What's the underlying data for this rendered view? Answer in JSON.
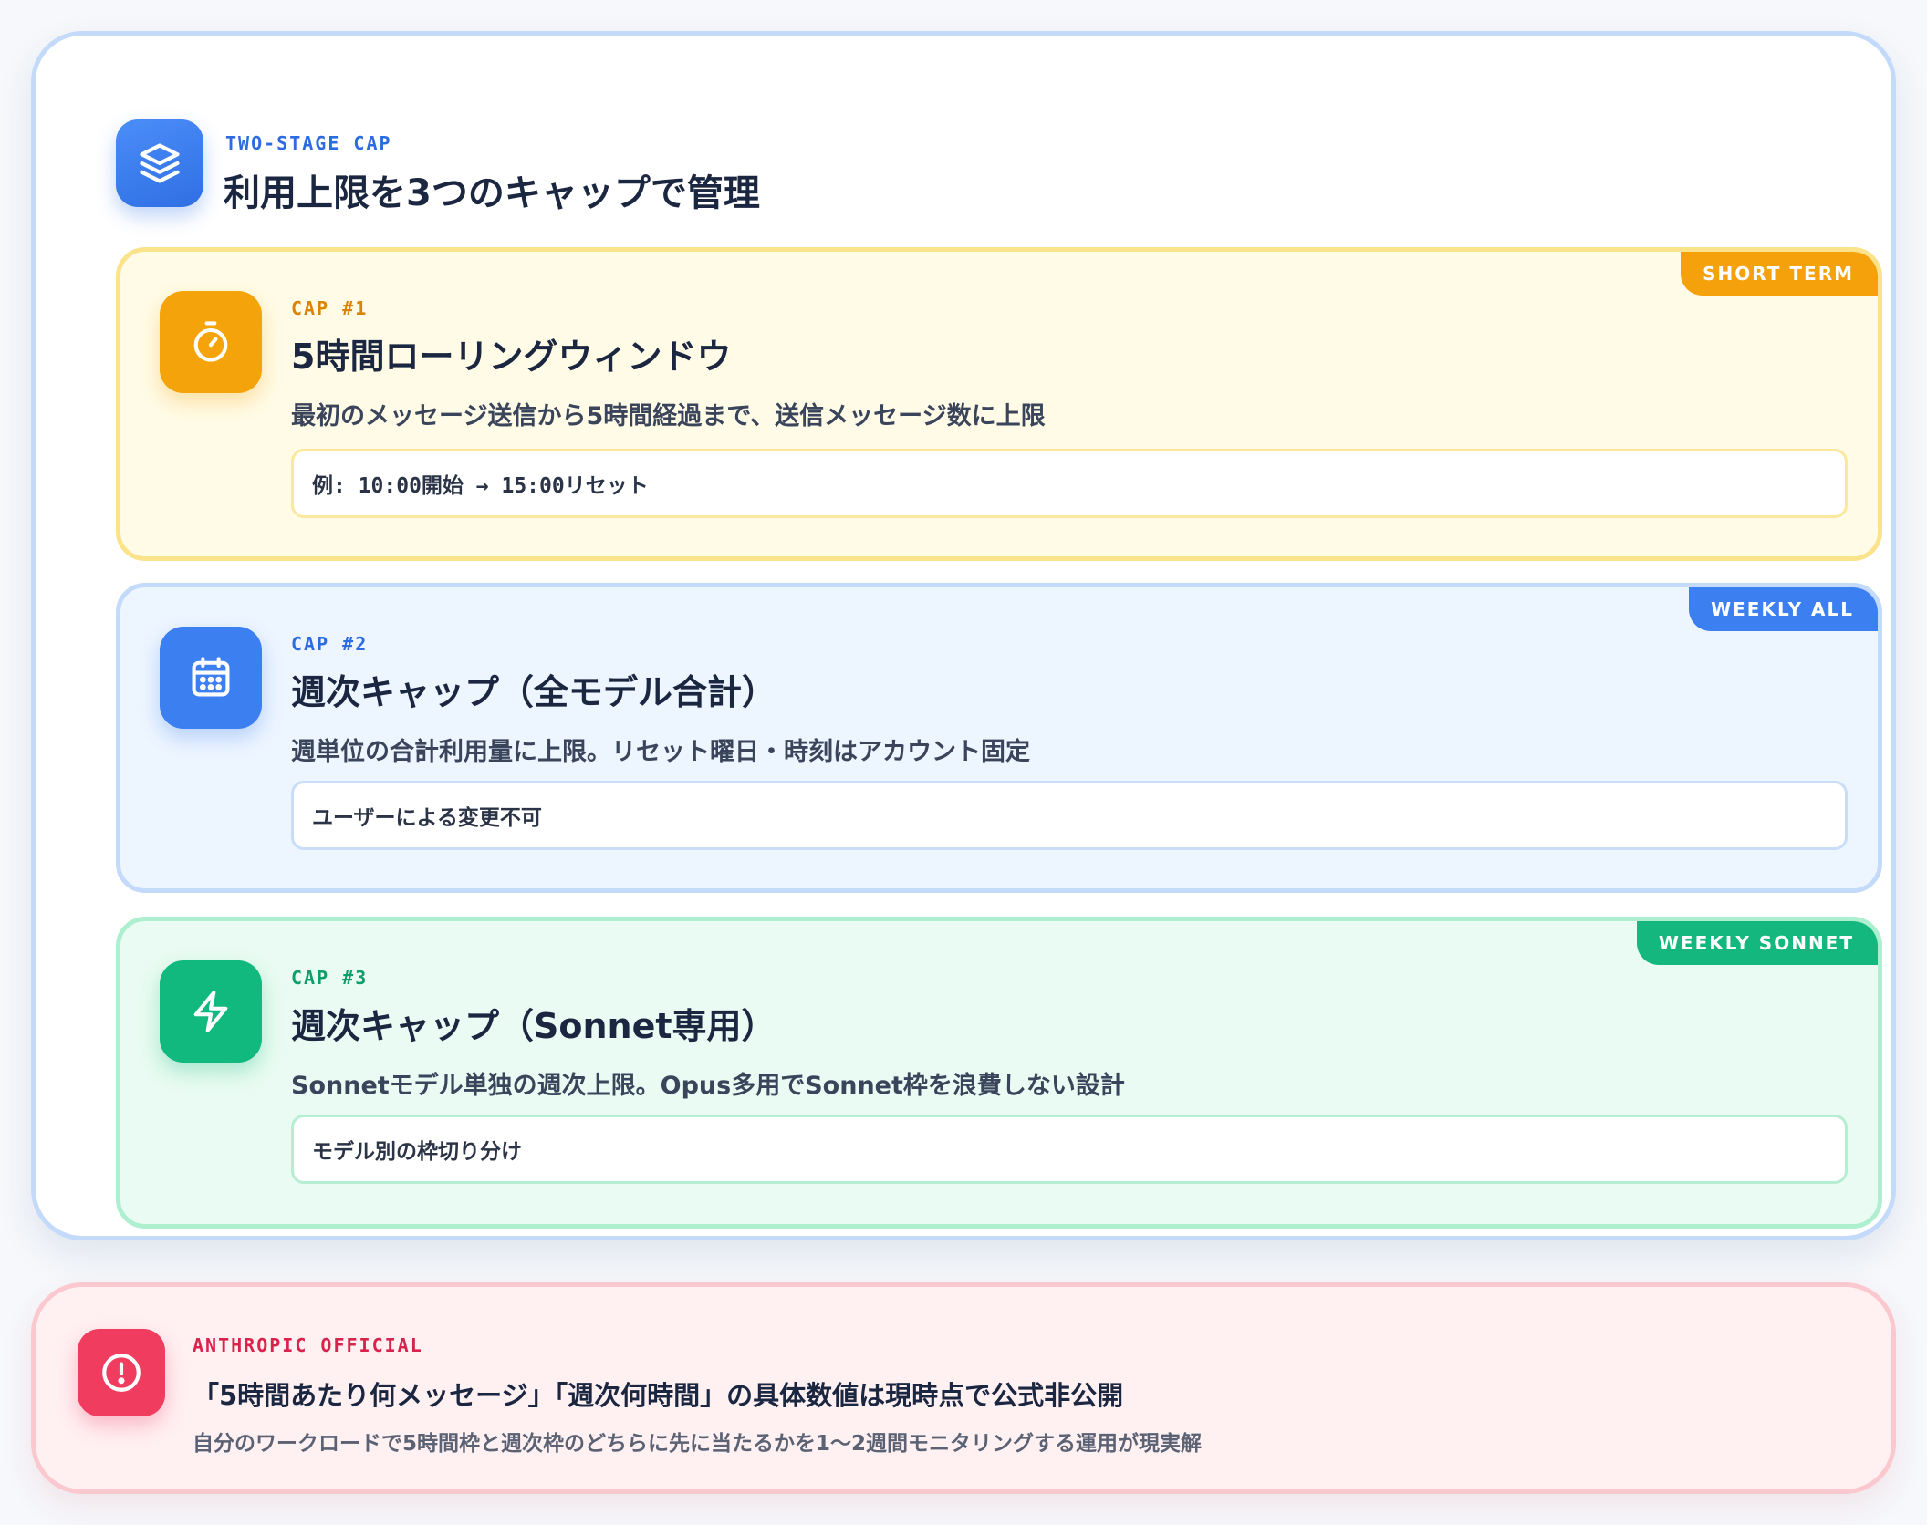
{
  "header": {
    "icon": "stacked-layers-icon",
    "eyebrow": "TWO-STAGE CAP",
    "title": "利用上限を3つのキャップで管理"
  },
  "caps": [
    {
      "icon": "stopwatch-icon",
      "tag": "SHORT TERM",
      "eyebrow": "CAP #1",
      "title": "5時間ローリングウィンドウ",
      "description": "最初のメッセージ送信から5時間経過まで、送信メッセージ数に上限",
      "note": "例: 10:00開始 → 15:00リセット",
      "accent": "#f4a10c"
    },
    {
      "icon": "calendar-icon",
      "tag": "WEEKLY ALL",
      "eyebrow": "CAP #2",
      "title": "週次キャップ（全モデル合計）",
      "description": "週単位の合計利用量に上限。リセット曜日・時刻はアカウント固定",
      "note": "ユーザーによる変更不可",
      "accent": "#3b7ff0"
    },
    {
      "icon": "lightning-bolt-icon",
      "tag": "WEEKLY SONNET",
      "eyebrow": "CAP #3",
      "title": "週次キャップ（Sonnet専用）",
      "description": "Sonnetモデル単独の週次上限。Opus多用でSonnet枠を浪費しない設計",
      "note": "モデル別の枠切り分け",
      "accent": "#14b87e"
    }
  ],
  "alert": {
    "icon": "exclamation-circle-icon",
    "eyebrow": "ANTHROPIC OFFICIAL",
    "title": "「5時間あたり何メッセージ」「週次何時間」の具体数値は現時点で公式非公開",
    "description": "自分のワークロードで5時間枠と週次枠のどちらに先に当たるかを1〜2週間モニタリングする運用が現実解",
    "accent": "#ef3c5f"
  }
}
